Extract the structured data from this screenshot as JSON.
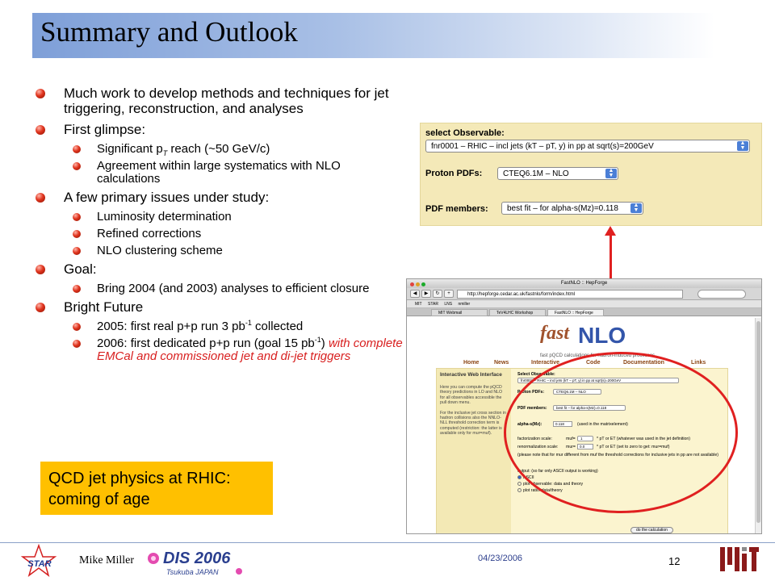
{
  "title": "Summary and Outlook",
  "bullets": {
    "b1": "Much work to develop methods and techniques for jet triggering, reconstruction, and analyses",
    "b2": "First glimpse:",
    "b2_1_pre": "Significant p",
    "b2_1_sub": "T",
    "b2_1_post": " reach (~50 GeV/c)",
    "b2_2": "Agreement within large systematics with NLO calculations",
    "b3": "A few primary issues under study:",
    "b3_1": "Luminosity determination",
    "b3_2": "Refined corrections",
    "b3_3": "NLO clustering scheme",
    "b4": "Goal:",
    "b4_1": "Bring 2004 (and 2003) analyses to efficient closure",
    "b5": "Bright Future",
    "b5_1_pre": "2005: first real p+p run 3 pb",
    "b5_1_sup": "-1",
    "b5_1_post": " collected",
    "b5_2_pre": "2006: first dedicated p+p run (goal 15 pb",
    "b5_2_sup": "-1",
    "b5_2_post": ")",
    "b5_2_red": "with complete EMCal and commissioned jet and di-jet triggers"
  },
  "callout": {
    "line1": "QCD jet physics at RHIC:",
    "line2": "coming of age"
  },
  "observable_panel": {
    "select_observable_label": "select Observable:",
    "select_observable_value": "fnr0001 – RHIC – incl jets (kT – pT, y) in pp at sqrt(s)=200GeV",
    "proton_pdfs_label": "Proton PDFs:",
    "proton_pdfs_value": "CTEQ6.1M – NLO",
    "pdf_members_label": "PDF members:",
    "pdf_members_value": "best fit – for alpha-s(Mz)=0.118"
  },
  "browser": {
    "window_title": "FastNLO :: HepForge",
    "url": "http://hepforge.cedar.ac.uk/fastnlo/form/index.html",
    "bookmarks": [
      "MIT",
      "STAR",
      "LNS",
      "nmiller"
    ],
    "tabs": [
      "MIT Webmail",
      "TeV4LHC Workshop",
      "FastNLO :: HepForge"
    ],
    "logo_fast": "fast",
    "logo_nlo": "NLO",
    "logo_sub": "fast pQCD calculations for hadron-induced processes",
    "nav": [
      "Home",
      "News",
      "Interactive",
      "Code",
      "Documentation",
      "Links"
    ],
    "side_title": "Interactive Web Interface",
    "side_p1": "Here you can compute the pQCD theory predictions in LO and NLO for all observables accessible the pull down menu.",
    "side_p2": "For the inclusive jet cross section in hadron collisions also the NNLO-NLL threshold correction term is computed (restriction: the latter is available only for mur=muf).",
    "form": {
      "select_observable": "Select Observable:",
      "observable_value": "fnr0001 – RHIC – incl jets (kT – pT, y) in pp at sqrt(s)=200GeV",
      "proton_pdfs": "Proton PDFs:",
      "pdfs_value": "CTEQ6.1M – NLO",
      "pdf_members": "PDF members:",
      "members_value": "best fit – for alpha-s(Mz)=0.118",
      "alpha_s": "alpha-s(Mz):",
      "alpha_value": "0.118",
      "alpha_note": "(used in the matrixelement)",
      "fact_scale": "factorization scale:",
      "muf_label": "muf=",
      "muf_value": "1",
      "muf_note": "* pT or ET   (whatever was used in the jet definition)",
      "renorm_scale": "renormalization scale:",
      "mur_label": "mur=",
      "mur_value": "0.0",
      "mur_note": "* pT or ET   (set to zero to get: mur=muf)",
      "note": "(please note that for mur different from muf the threshold corrections for inclusive jets in pp are not available)",
      "output": "output: (so far only ASCII output is working)",
      "opt_ascii": "ASCII",
      "opt_plot_obs": "plot observable: data and theory",
      "opt_plot_ratio": "plot ratio: data/theory",
      "calc_button": "do the calculation"
    }
  },
  "footer": {
    "presenter": "Mike Miller",
    "date": "04/23/2006",
    "page": "12",
    "star_text": "STAR",
    "dis_text": "DIS 2006",
    "dis_sub": "Tsukuba JAPAN"
  },
  "colors": {
    "accent_red": "#e02020",
    "callout_yellow": "#ffc000",
    "title_blue": "#7e9fd8",
    "red_text": "#d81f1f"
  }
}
